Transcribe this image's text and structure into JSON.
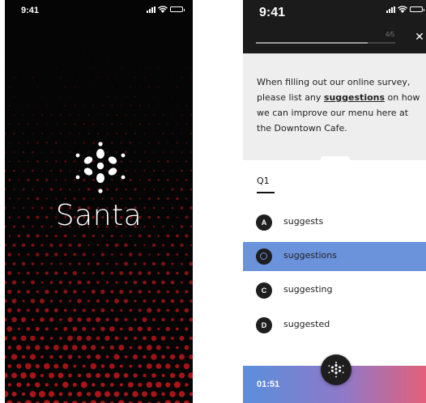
{
  "colors": {
    "splash_background": "#050505",
    "dot_color": "#c4161c",
    "header_background": "#1b1b1b",
    "passage_background": "#eeeeee",
    "selected_option": "#6b93dc",
    "footer_gradient_start": "#5a8fdc",
    "footer_gradient_end": "#e2607a"
  },
  "splash": {
    "status": {
      "time": "9:41",
      "icons": [
        "signal-icon",
        "wifi-icon",
        "battery-icon"
      ]
    },
    "logo_icon": "santa-snowflake-logo-icon",
    "brand_name": "Santa"
  },
  "quiz": {
    "status": {
      "time": "9:41",
      "icons": [
        "signal-icon",
        "wifi-icon",
        "battery-icon"
      ]
    },
    "progress": {
      "label": "4/5",
      "current": 4,
      "total": 5
    },
    "close_icon": "close-icon",
    "passage": {
      "before": "When filling out our online survey, please list any ",
      "keyword": "suggestions",
      "after": " on how we can improve our menu here at the Downtown Cafe."
    },
    "question_label": "Q1",
    "options": [
      {
        "badge": "A",
        "label": "suggests",
        "selected": false
      },
      {
        "badge": "",
        "label": "suggestions",
        "selected": true
      },
      {
        "badge": "C",
        "label": "suggesting",
        "selected": false
      },
      {
        "badge": "D",
        "label": "suggested",
        "selected": false
      }
    ],
    "timer": "01:51",
    "fab_icon": "santa-snowflake-logo-icon"
  }
}
